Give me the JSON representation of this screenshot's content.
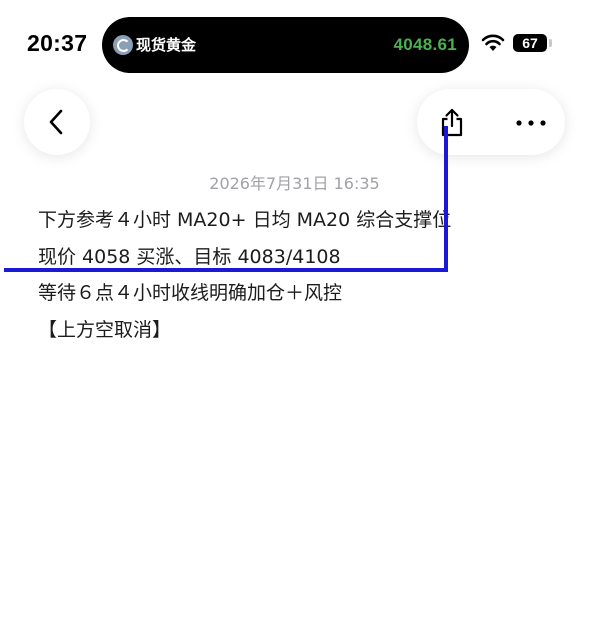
{
  "status_bar": {
    "time": "20:37",
    "live_activity": {
      "title": "现货黄金",
      "price": "4048.61"
    },
    "battery": "67"
  },
  "header": {
    "back_icon": "chevron-left-icon",
    "share_icon": "share-icon",
    "more_icon": "more-horizontal-icon"
  },
  "post": {
    "timestamp": "2026年7月31日 16:35",
    "lines": [
      "下方参考４小时 MA20+ 日均 MA20 综合支撑位",
      "现价 4058 买涨、目标 4083/4108",
      "等待６点４小时收线明确加仓＋风控",
      "【上方空取消】"
    ]
  },
  "colors": {
    "price_green": "#4caf50",
    "annotation_blue": "#1a1ad6",
    "timestamp_gray": "#a1a1a6",
    "text": "#1c1c1e"
  }
}
